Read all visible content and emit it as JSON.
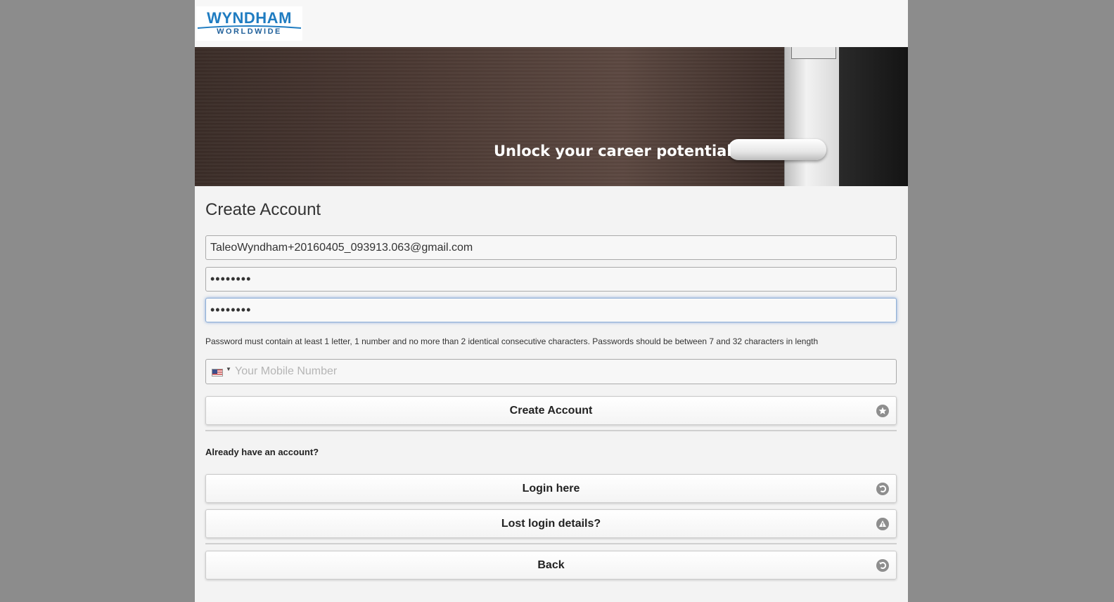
{
  "logo": {
    "brand": "WYNDHAM",
    "subtitle": "WORLDWIDE"
  },
  "banner": {
    "tagline": "Unlock your career potential"
  },
  "form": {
    "title": "Create Account",
    "email_value": "TaleoWyndham+20160405_093913.063@gmail.com",
    "password_value": "••••••••",
    "confirm_password_value": "••••••••",
    "password_hint": "Password must contain at least 1 letter, 1 number and no more than 2 identical consecutive characters. Passwords should be between 7 and 32 characters in length",
    "phone_placeholder": "Your Mobile Number",
    "phone_country": "US",
    "create_button": "Create Account"
  },
  "login": {
    "prompt": "Already have an account?",
    "login_button": "Login here",
    "lost_button": "Lost login details?",
    "back_button": "Back"
  },
  "colors": {
    "brand_blue": "#1f7cc1",
    "icon_gray": "#8e8e8e",
    "background": "#8c8c8c"
  },
  "icons": {
    "create": "star-icon",
    "login": "arrow-circle-icon",
    "lost": "warning-icon",
    "back": "arrow-circle-icon"
  }
}
